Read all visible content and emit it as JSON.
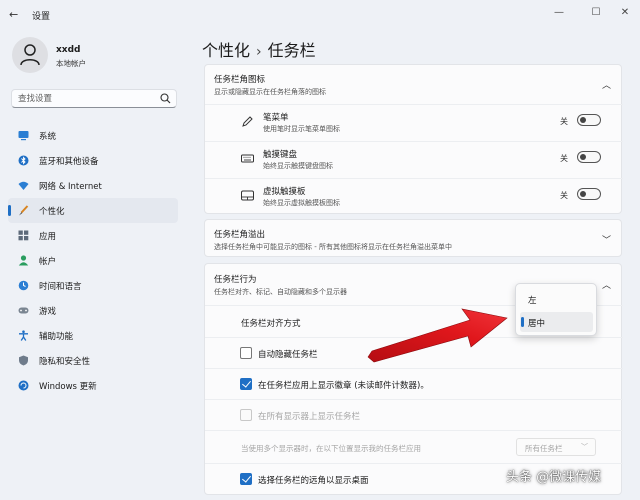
{
  "window": {
    "title": "设置"
  },
  "user": {
    "name": "xxdd",
    "account_type": "本地帐户"
  },
  "search": {
    "placeholder": "查找设置"
  },
  "sidebar": {
    "items": [
      {
        "label": "系统",
        "icon": "monitor-icon",
        "active": false
      },
      {
        "label": "蓝牙和其他设备",
        "icon": "bluetooth-icon",
        "active": false
      },
      {
        "label": "网络 & Internet",
        "icon": "wifi-icon",
        "active": false
      },
      {
        "label": "个性化",
        "icon": "brush-icon",
        "active": true
      },
      {
        "label": "应用",
        "icon": "apps-icon",
        "active": false
      },
      {
        "label": "帐户",
        "icon": "person-icon",
        "active": false
      },
      {
        "label": "时间和语言",
        "icon": "globe-clock-icon",
        "active": false
      },
      {
        "label": "游戏",
        "icon": "gamepad-icon",
        "active": false
      },
      {
        "label": "辅助功能",
        "icon": "accessibility-icon",
        "active": false
      },
      {
        "label": "隐私和安全性",
        "icon": "shield-icon",
        "active": false
      },
      {
        "label": "Windows 更新",
        "icon": "update-icon",
        "active": false
      }
    ]
  },
  "breadcrumb": {
    "parent": "个性化",
    "separator": "›",
    "current": "任务栏"
  },
  "corner_icons": {
    "title": "任务栏角图标",
    "subtitle": "显示或隐藏显示在任务栏角落的图标",
    "items": [
      {
        "title": "笔菜单",
        "subtitle": "使用笔时显示笔菜单图标",
        "state": "关",
        "icon": "pen-icon"
      },
      {
        "title": "触摸键盘",
        "subtitle": "始终显示触摸键盘图标",
        "state": "关",
        "icon": "keyboard-icon"
      },
      {
        "title": "虚拟触摸板",
        "subtitle": "始终显示虚拟触摸板图标",
        "state": "关",
        "icon": "touchpad-icon"
      }
    ]
  },
  "corner_overflow": {
    "title": "任务栏角溢出",
    "subtitle": "选择任务栏角中可能显示的图标 - 所有其他图标将显示在任务栏角溢出菜单中"
  },
  "behaviors": {
    "title": "任务栏行为",
    "subtitle": "任务栏对齐、标记、自动隐藏和多个显示器",
    "alignment_label": "任务栏对齐方式",
    "alignment_options": [
      "左",
      "居中"
    ],
    "alignment_selected": "居中",
    "auto_hide": {
      "label": "自动隐藏任务栏",
      "checked": false
    },
    "badges": {
      "label": "在任务栏应用上显示徽章 (未读邮件计数器)。",
      "checked": true
    },
    "all_displays": {
      "label": "在所有显示器上显示任务栏",
      "checked": false,
      "disabled": true
    },
    "multi_display": {
      "label": "当使用多个显示器时，在以下位置显示我的任务栏应用",
      "value": "所有任务栏"
    },
    "far_corner": {
      "label": "选择任务栏的远角以显示桌面",
      "checked": true
    }
  },
  "watermark": "头条 @微课传媒",
  "colors": {
    "accent": "#1f6fc5",
    "arrow": "#e0171c",
    "background": "#eef1f6"
  }
}
